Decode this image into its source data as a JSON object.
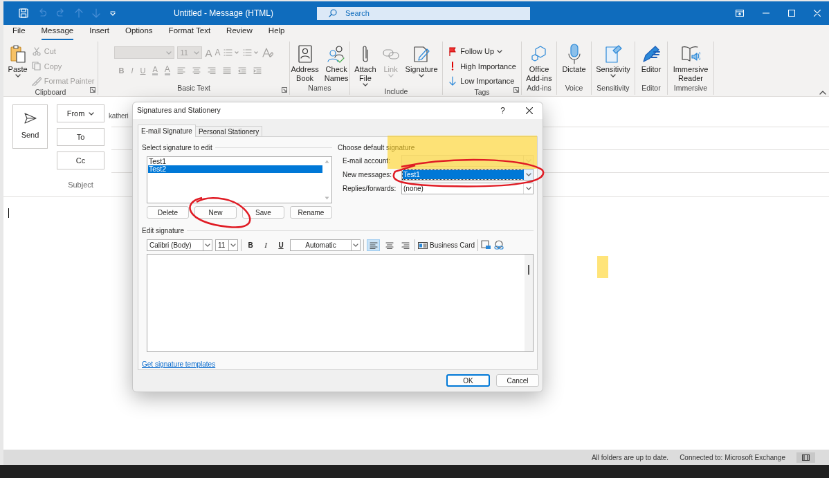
{
  "window": {
    "title": "Untitled  -  Message (HTML)",
    "search_placeholder": "Search"
  },
  "menu_tabs": [
    {
      "label": "File",
      "selected": false
    },
    {
      "label": "Message",
      "selected": true
    },
    {
      "label": "Insert",
      "selected": false
    },
    {
      "label": "Options",
      "selected": false
    },
    {
      "label": "Format Text",
      "selected": false
    },
    {
      "label": "Review",
      "selected": false
    },
    {
      "label": "Help",
      "selected": false
    }
  ],
  "ribbon": {
    "groups": [
      {
        "label": "Clipboard",
        "launcher": true,
        "items": [
          {
            "kind": "large",
            "lines": [
              "Paste"
            ],
            "dropdown": true,
            "disabled": false
          },
          {
            "kind": "small",
            "label": "Cut",
            "disabled": true
          },
          {
            "kind": "small",
            "label": "Copy",
            "disabled": true
          },
          {
            "kind": "small",
            "label": "Format Painter",
            "disabled": true
          }
        ]
      },
      {
        "label": "Basic Text",
        "launcher": true,
        "items": [
          {
            "kind": "basic_text",
            "size": "11",
            "grow": "A",
            "shrink": "A",
            "bold": "B",
            "italic": "I",
            "underline": "U",
            "highlight": "A",
            "font_color": "A",
            "disabled": true
          }
        ]
      },
      {
        "label": "Names",
        "launcher": false,
        "items": [
          {
            "kind": "large",
            "lines": [
              "Address",
              "Book"
            ],
            "dropdown": false,
            "disabled": false
          },
          {
            "kind": "large",
            "lines": [
              "Check",
              "Names"
            ],
            "dropdown": false,
            "disabled": false
          }
        ]
      },
      {
        "label": "Include",
        "launcher": false,
        "items": [
          {
            "kind": "large",
            "lines": [
              "Attach",
              "File"
            ],
            "dropdown": true,
            "disabled": false
          },
          {
            "kind": "large",
            "lines": [
              "Link"
            ],
            "dropdown": true,
            "disabled": true
          },
          {
            "kind": "large",
            "lines": [
              "Signature"
            ],
            "dropdown": true,
            "disabled": false
          }
        ]
      },
      {
        "label": "Tags",
        "launcher": true,
        "items": [
          {
            "kind": "small",
            "label": "Follow Up",
            "dropdown": true,
            "disabled": false
          },
          {
            "kind": "small",
            "label": "High Importance",
            "disabled": false
          },
          {
            "kind": "small",
            "label": "Low Importance",
            "disabled": false
          }
        ]
      },
      {
        "label": "Add-ins",
        "launcher": false,
        "items": [
          {
            "kind": "large",
            "lines": [
              "Office",
              "Add-ins"
            ],
            "dropdown": false,
            "disabled": false
          }
        ]
      },
      {
        "label": "Voice",
        "launcher": false,
        "items": [
          {
            "kind": "large",
            "lines": [
              "Dictate"
            ],
            "dropdown": false,
            "disabled": false
          }
        ]
      },
      {
        "label": "Sensitivity",
        "launcher": false,
        "items": [
          {
            "kind": "large",
            "lines": [
              "Sensitivity"
            ],
            "dropdown": true,
            "disabled": false
          }
        ]
      },
      {
        "label": "Editor",
        "launcher": false,
        "items": [
          {
            "kind": "large",
            "lines": [
              "Editor"
            ],
            "dropdown": false,
            "disabled": false
          }
        ]
      },
      {
        "label": "Immersive",
        "launcher": false,
        "items": [
          {
            "kind": "large",
            "lines": [
              "Immersive",
              "Reader"
            ],
            "dropdown": false,
            "disabled": false
          }
        ]
      }
    ]
  },
  "compose": {
    "send": "Send",
    "from": "From",
    "to": "To",
    "cc": "Cc",
    "subject": "Subject",
    "from_value": "katheri"
  },
  "dialog": {
    "title": "Signatures and Stationery",
    "help": "?",
    "tabs": [
      {
        "label": "E-mail Signature",
        "selected": true
      },
      {
        "label": "Personal Stationery",
        "selected": false
      }
    ],
    "select_label": "Select signature to edit",
    "signatures": [
      {
        "name": "Test1",
        "selected": false
      },
      {
        "name": "Test2",
        "selected": true
      }
    ],
    "buttons": [
      "Delete",
      "New",
      "Save",
      "Rename"
    ],
    "defaults_label": "Choose default signature",
    "fields": [
      {
        "label": "E-mail account:",
        "disabled": true,
        "highlighted": false
      },
      {
        "label": "New messages:",
        "value": "Test1",
        "disabled": false,
        "highlighted": true
      },
      {
        "label": "Replies/forwards:",
        "value": "(none)",
        "disabled": false,
        "highlighted": false
      }
    ],
    "edit_label": "Edit signature",
    "toolbar": {
      "font": "Calibri (Body)",
      "size": "11",
      "bold": "B",
      "italic": "I",
      "underline": "U",
      "color_label": "Automatic",
      "align": [
        {
          "selected": true
        },
        {
          "selected": false
        },
        {
          "selected": false
        }
      ],
      "business_card": "Business Card"
    },
    "templates_link": "Get signature templates",
    "ok": "OK",
    "cancel": "Cancel"
  },
  "status_bar": {
    "sync": "All folders are up to date.",
    "connection": "Connected to: Microsoft Exchange"
  }
}
